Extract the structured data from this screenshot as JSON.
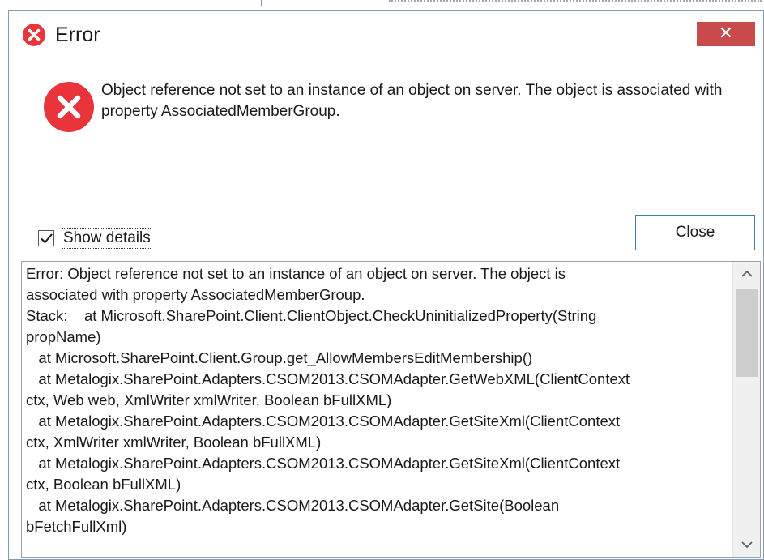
{
  "dialog": {
    "title": "Error",
    "close_x": "✕",
    "message": "Object reference not set to an instance of an object on server. The object is associated with property AssociatedMemberGroup.",
    "show_details_label": "Show details",
    "show_details_checked": true,
    "close_button_label": "Close",
    "details_text": "Error: Object reference not set to an instance of an object on server. The object is\nassociated with property AssociatedMemberGroup.\nStack:    at Microsoft.SharePoint.Client.ClientObject.CheckUninitializedProperty(String\npropName)\n   at Microsoft.SharePoint.Client.Group.get_AllowMembersEditMembership()\n   at Metalogix.SharePoint.Adapters.CSOM2013.CSOMAdapter.GetWebXML(ClientContext\nctx, Web web, XmlWriter xmlWriter, Boolean bFullXML)\n   at Metalogix.SharePoint.Adapters.CSOM2013.CSOMAdapter.GetSiteXml(ClientContext\nctx, XmlWriter xmlWriter, Boolean bFullXML)\n   at Metalogix.SharePoint.Adapters.CSOM2013.CSOMAdapter.GetSiteXml(ClientContext\nctx, Boolean bFullXML)\n   at Metalogix.SharePoint.Adapters.CSOM2013.CSOMAdapter.GetSite(Boolean\nbFetchFullXml)"
  },
  "icons": {
    "title_icon": "error-icon",
    "message_icon": "error-icon",
    "checkbox_icon": "checkmark-icon",
    "scroll_up": "chevron-up-icon",
    "scroll_down": "chevron-down-icon"
  },
  "colors": {
    "error_red": "#e8343a",
    "close_x_bg": "#c84a4a",
    "button_border": "#3c7fb1"
  }
}
